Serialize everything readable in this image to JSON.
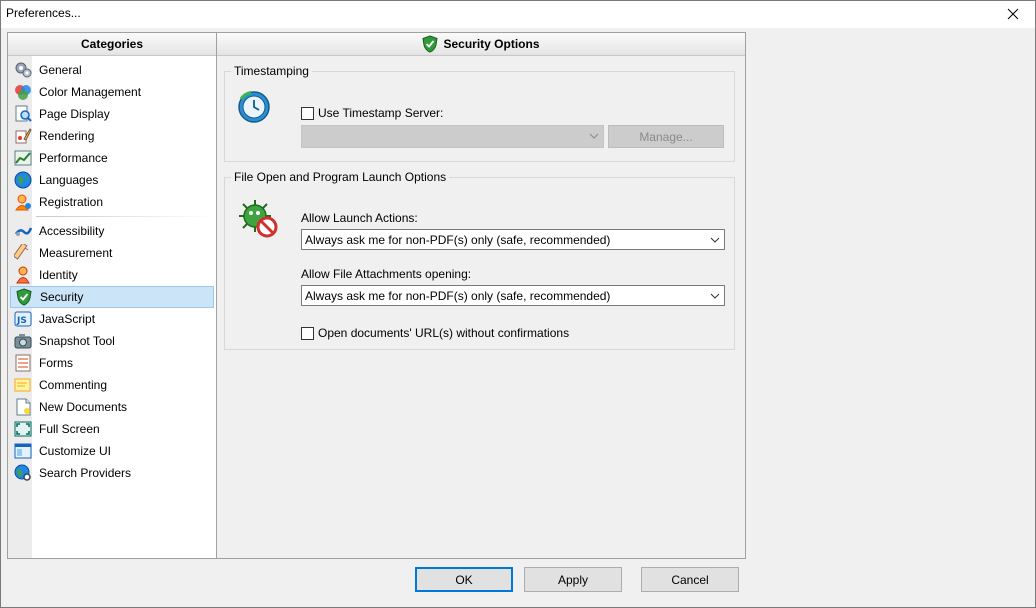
{
  "window": {
    "title": "Preferences..."
  },
  "categories": {
    "header": "Categories",
    "group1": [
      {
        "key": "general",
        "label": "General",
        "icon": "gears-icon"
      },
      {
        "key": "color-management",
        "label": "Color Management",
        "icon": "color-circles-icon"
      },
      {
        "key": "page-display",
        "label": "Page Display",
        "icon": "page-magnifier-icon"
      },
      {
        "key": "rendering",
        "label": "Rendering",
        "icon": "brush-icon"
      },
      {
        "key": "performance",
        "label": "Performance",
        "icon": "chart-icon"
      },
      {
        "key": "languages",
        "label": "Languages",
        "icon": "globe-icon"
      },
      {
        "key": "registration",
        "label": "Registration",
        "icon": "user-icon"
      }
    ],
    "group2": [
      {
        "key": "accessibility",
        "label": "Accessibility",
        "icon": "accessibility-icon"
      },
      {
        "key": "measurement",
        "label": "Measurement",
        "icon": "ruler-icon"
      },
      {
        "key": "identity",
        "label": "Identity",
        "icon": "person-icon"
      },
      {
        "key": "security",
        "label": "Security",
        "icon": "shield-icon",
        "selected": true
      },
      {
        "key": "javascript",
        "label": "JavaScript",
        "icon": "js-icon"
      },
      {
        "key": "snapshot-tool",
        "label": "Snapshot Tool",
        "icon": "camera-icon"
      },
      {
        "key": "forms",
        "label": "Forms",
        "icon": "form-icon"
      },
      {
        "key": "commenting",
        "label": "Commenting",
        "icon": "note-icon"
      },
      {
        "key": "new-documents",
        "label": "New Documents",
        "icon": "document-icon"
      },
      {
        "key": "full-screen",
        "label": "Full Screen",
        "icon": "fullscreen-icon"
      },
      {
        "key": "customize-ui",
        "label": "Customize UI",
        "icon": "customize-icon"
      },
      {
        "key": "search-providers",
        "label": "Search Providers",
        "icon": "search-globe-icon"
      }
    ]
  },
  "options": {
    "header": "Security Options",
    "timestamping": {
      "legend": "Timestamping",
      "use_server_label": "Use Timestamp Server:",
      "use_server_checked": false,
      "server_value": "",
      "manage_label": "Manage..."
    },
    "launch": {
      "legend": "File Open and Program Launch Options",
      "allow_launch_label": "Allow Launch Actions:",
      "allow_launch_value": "Always ask me for non-PDF(s) only (safe, recommended)",
      "allow_attach_label": "Allow File Attachments opening:",
      "allow_attach_value": "Always ask me for non-PDF(s) only (safe, recommended)",
      "open_url_label": "Open documents' URL(s) without confirmations",
      "open_url_checked": false
    }
  },
  "footer": {
    "ok": "OK",
    "apply": "Apply",
    "cancel": "Cancel"
  },
  "colors": {
    "selection": "#cce4f7",
    "selection_border": "#99c9ef",
    "accent": "#0078d7"
  }
}
